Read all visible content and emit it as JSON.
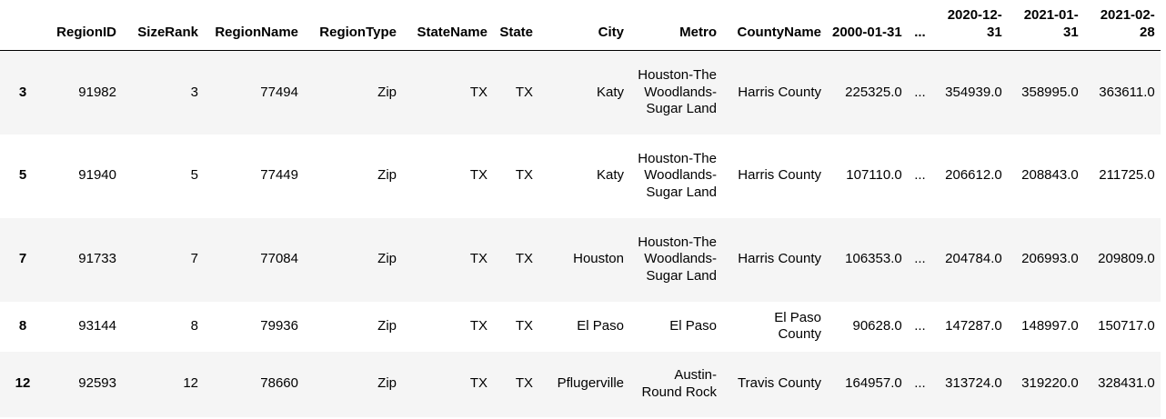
{
  "table": {
    "columns": [
      "RegionID",
      "SizeRank",
      "RegionName",
      "RegionType",
      "StateName",
      "State",
      "City",
      "Metro",
      "CountyName",
      "2000-01-31",
      "...",
      "2020-12-31",
      "2021-01-31",
      "2021-02-28"
    ],
    "rows": [
      {
        "index": "3",
        "cells": [
          "91982",
          "3",
          "77494",
          "Zip",
          "TX",
          "TX",
          "Katy",
          "Houston-The Woodlands-Sugar Land",
          "Harris County",
          "225325.0",
          "...",
          "354939.0",
          "358995.0",
          "363611.0"
        ]
      },
      {
        "index": "5",
        "cells": [
          "91940",
          "5",
          "77449",
          "Zip",
          "TX",
          "TX",
          "Katy",
          "Houston-The Woodlands-Sugar Land",
          "Harris County",
          "107110.0",
          "...",
          "206612.0",
          "208843.0",
          "211725.0"
        ]
      },
      {
        "index": "7",
        "cells": [
          "91733",
          "7",
          "77084",
          "Zip",
          "TX",
          "TX",
          "Houston",
          "Houston-The Woodlands-Sugar Land",
          "Harris County",
          "106353.0",
          "...",
          "204784.0",
          "206993.0",
          "209809.0"
        ]
      },
      {
        "index": "8",
        "cells": [
          "93144",
          "8",
          "79936",
          "Zip",
          "TX",
          "TX",
          "El Paso",
          "El Paso",
          "El Paso County",
          "90628.0",
          "...",
          "147287.0",
          "148997.0",
          "150717.0"
        ]
      },
      {
        "index": "12",
        "cells": [
          "92593",
          "12",
          "78660",
          "Zip",
          "TX",
          "TX",
          "Pflugerville",
          "Austin-Round Rock",
          "Travis County",
          "164957.0",
          "...",
          "313724.0",
          "319220.0",
          "328431.0"
        ]
      }
    ]
  }
}
